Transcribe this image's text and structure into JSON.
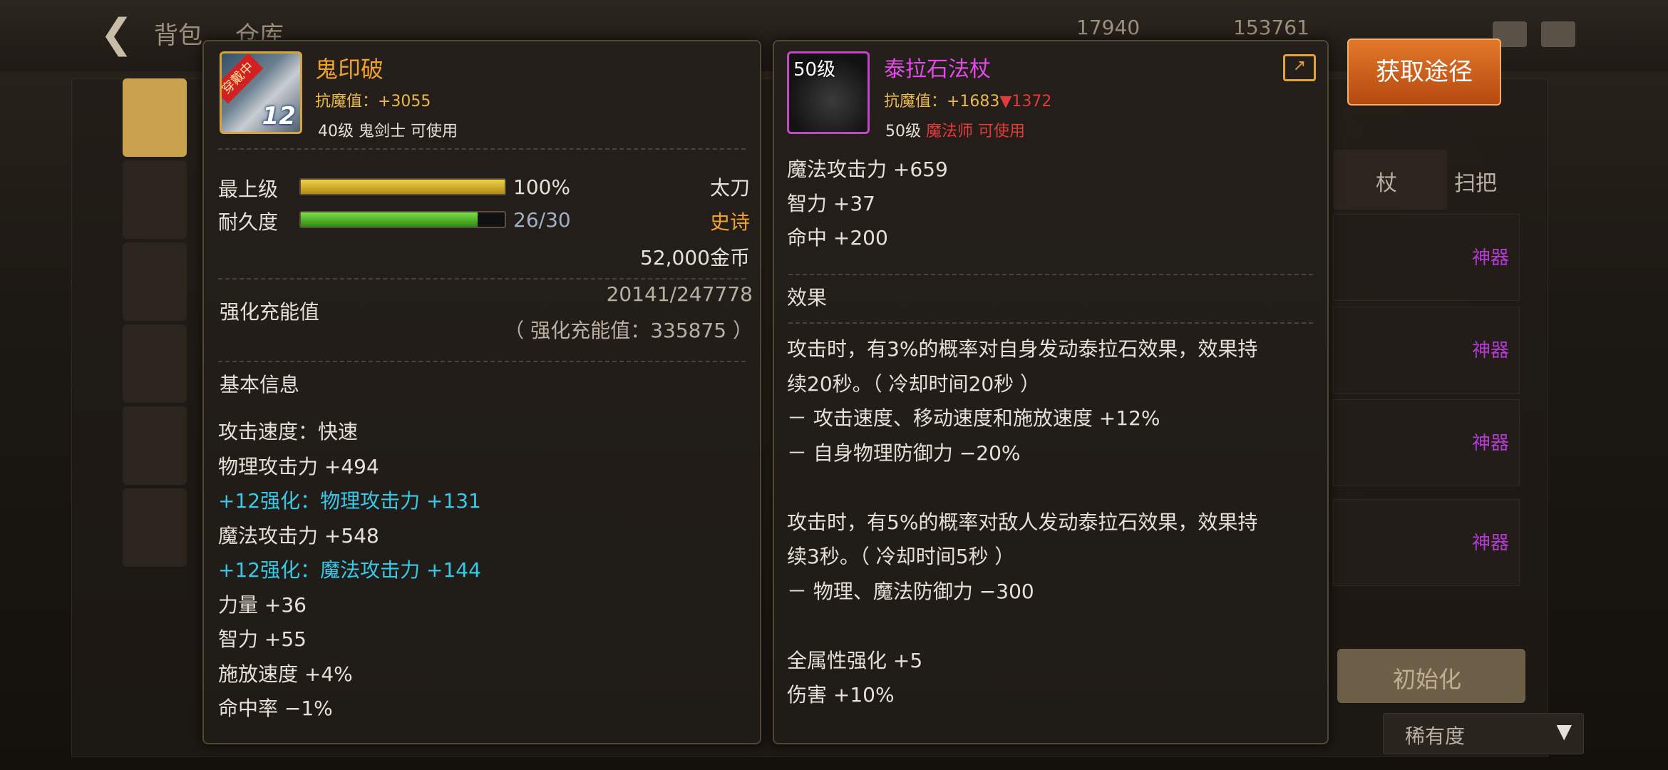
{
  "topbar": {
    "tabs": [
      "背包",
      "仓库"
    ],
    "currency": [
      "17940",
      "153761"
    ]
  },
  "left_item": {
    "name": "鬼印破",
    "anti_magic": "抗魔值：+3055",
    "level_req": "40级 鬼剑士 可使用",
    "equipped_badge": "穿戴中",
    "enhance_level": "12",
    "grade_label": "最上级",
    "grade_value": "100%",
    "grade_fraction": 1.0,
    "durability_label": "耐久度",
    "durability_value": "26/30",
    "durability_fraction": 0.8667,
    "weapon_type": "太刀",
    "rarity": "史诗",
    "price": "52,000金币",
    "charge_label": "强化充能值",
    "charge_value": "20141/247778",
    "charge_total": "（ 强化充能值：335875 ）",
    "basic_info_title": "基本信息",
    "stats": [
      {
        "text": "攻击速度：快速",
        "color": "white"
      },
      {
        "text": "物理攻击力 +494",
        "color": "white"
      },
      {
        "text": "+12强化：物理攻击力 +131",
        "color": "cyan"
      },
      {
        "text": "魔法攻击力 +548",
        "color": "white"
      },
      {
        "text": "+12强化：魔法攻击力 +144",
        "color": "cyan"
      },
      {
        "text": "力量 +36",
        "color": "white"
      },
      {
        "text": "智力 +55",
        "color": "white"
      },
      {
        "text": "施放速度 +4%",
        "color": "white"
      },
      {
        "text": "命中率 −1%",
        "color": "white"
      }
    ]
  },
  "right_item": {
    "level_badge": "50级",
    "name": "泰拉石法杖",
    "anti_magic_prefix": "抗魔值：+1683",
    "anti_magic_delta": "▼1372",
    "level_req_level": "50级",
    "level_req_class": "魔法师 可使用",
    "stats": [
      "魔法攻击力 +659",
      "智力 +37",
      "命中 +200"
    ],
    "effect_title": "效果",
    "effect_lines": [
      "攻击时，有3%的概率对自身发动泰拉石效果，效果持",
      "续20秒。（ 冷却时间20秒 ）",
      "－ 攻击速度、移动速度和施放速度 +12%",
      "－ 自身物理防御力 −20%",
      "",
      "攻击时，有5%的概率对敌人发动泰拉石效果，效果持",
      "续3秒。（ 冷却时间5秒 ）",
      "－ 物理、魔法防御力 −300",
      "",
      "全属性强化 +5",
      "伤害 +10%"
    ]
  },
  "get_source_button": "获取途径",
  "background": {
    "tab_labels": [
      "杖",
      "扫把"
    ],
    "list_tags": [
      "神器",
      "神器",
      "神器",
      "神器"
    ],
    "init_button": "初始化",
    "rarity_select": "稀有度"
  }
}
